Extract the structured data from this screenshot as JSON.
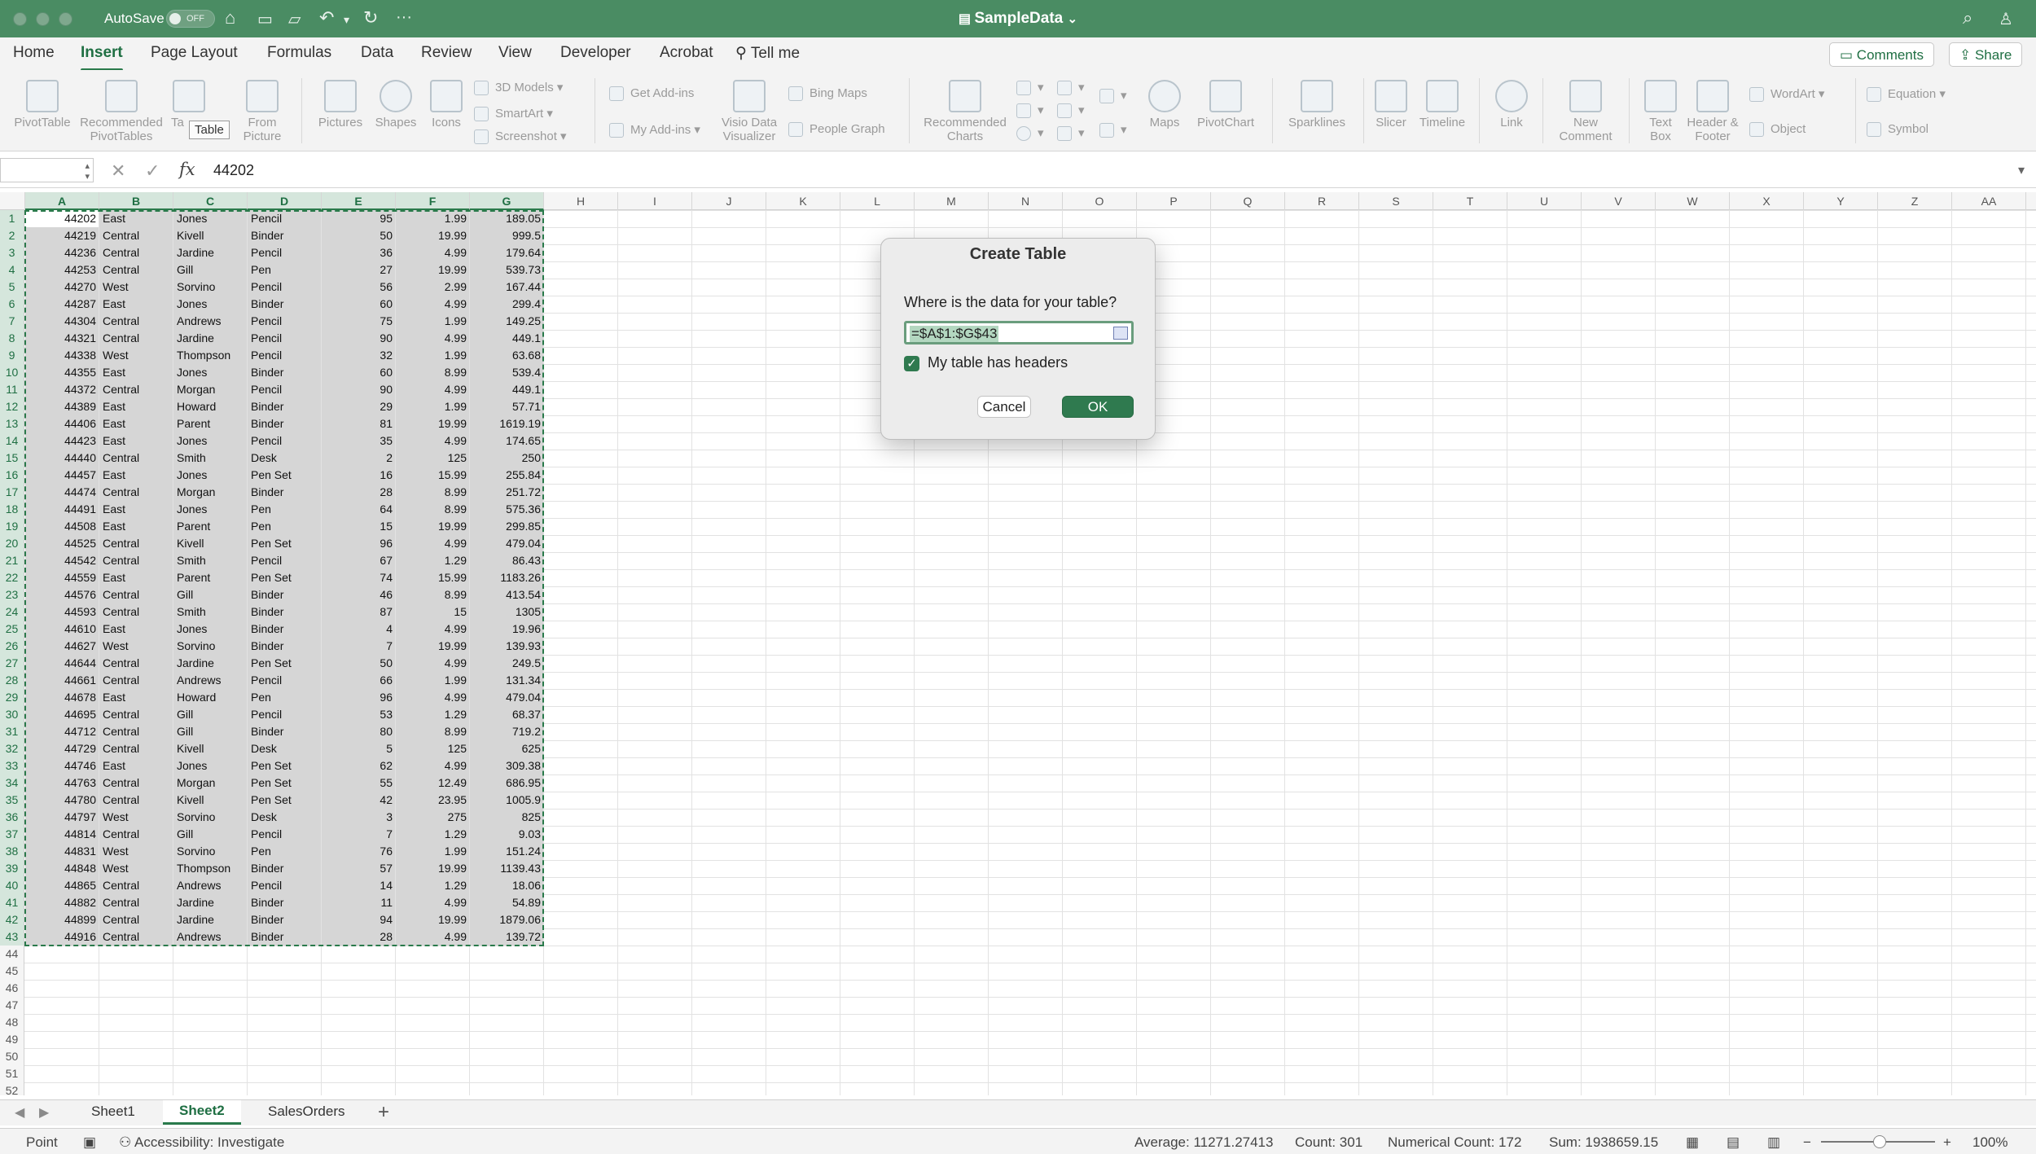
{
  "titlebar": {
    "autosave_label": "AutoSave",
    "autosave_state": "OFF",
    "doc_title": "SampleData",
    "title_chevron": "⌄"
  },
  "tabs": [
    "Home",
    "Insert",
    "Page Layout",
    "Formulas",
    "Data",
    "Review",
    "View",
    "Developer",
    "Acrobat",
    "Tell me"
  ],
  "active_tab": "Insert",
  "actions": {
    "comments": "Comments",
    "share": "Share"
  },
  "ribbon": {
    "pivottable": "PivotTable",
    "recommended_pivottables_1": "Recommended",
    "recommended_pivottables_2": "PivotTables",
    "table_partial": "Ta",
    "from_picture_1": "From",
    "from_picture_2": "Picture",
    "pictures": "Pictures",
    "shapes": "Shapes",
    "icons": "Icons",
    "models3d": "3D Models",
    "smartart": "SmartArt",
    "screenshot": "Screenshot",
    "get_addins": "Get Add-ins",
    "my_addins": "My Add-ins",
    "visio_1": "Visio Data",
    "visio_2": "Visualizer",
    "bing_maps": "Bing Maps",
    "people_graph": "People Graph",
    "recommended_charts_1": "Recommended",
    "recommended_charts_2": "Charts",
    "maps": "Maps",
    "pivotchart": "PivotChart",
    "sparklines": "Sparklines",
    "slicer": "Slicer",
    "timeline": "Timeline",
    "link": "Link",
    "new_comment_1": "New",
    "new_comment_2": "Comment",
    "textbox_1": "Text",
    "textbox_2": "Box",
    "header_footer_1": "Header &",
    "header_footer_2": "Footer",
    "wordart": "WordArt",
    "object": "Object",
    "equation": "Equation",
    "symbol": "Symbol",
    "tooltip": "Table"
  },
  "formula_bar": {
    "value": "44202"
  },
  "columns": [
    "A",
    "B",
    "C",
    "D",
    "E",
    "F",
    "G",
    "H",
    "I",
    "J",
    "K",
    "L",
    "M",
    "N",
    "O",
    "P",
    "Q",
    "R",
    "S",
    "T",
    "U",
    "V",
    "W",
    "X",
    "Y",
    "Z",
    "AA"
  ],
  "rows_count": 52,
  "table_rows": [
    [
      "44202",
      "East",
      "Jones",
      "Pencil",
      "95",
      "1.99",
      "189.05"
    ],
    [
      "44219",
      "Central",
      "Kivell",
      "Binder",
      "50",
      "19.99",
      "999.5"
    ],
    [
      "44236",
      "Central",
      "Jardine",
      "Pencil",
      "36",
      "4.99",
      "179.64"
    ],
    [
      "44253",
      "Central",
      "Gill",
      "Pen",
      "27",
      "19.99",
      "539.73"
    ],
    [
      "44270",
      "West",
      "Sorvino",
      "Pencil",
      "56",
      "2.99",
      "167.44"
    ],
    [
      "44287",
      "East",
      "Jones",
      "Binder",
      "60",
      "4.99",
      "299.4"
    ],
    [
      "44304",
      "Central",
      "Andrews",
      "Pencil",
      "75",
      "1.99",
      "149.25"
    ],
    [
      "44321",
      "Central",
      "Jardine",
      "Pencil",
      "90",
      "4.99",
      "449.1"
    ],
    [
      "44338",
      "West",
      "Thompson",
      "Pencil",
      "32",
      "1.99",
      "63.68"
    ],
    [
      "44355",
      "East",
      "Jones",
      "Binder",
      "60",
      "8.99",
      "539.4"
    ],
    [
      "44372",
      "Central",
      "Morgan",
      "Pencil",
      "90",
      "4.99",
      "449.1"
    ],
    [
      "44389",
      "East",
      "Howard",
      "Binder",
      "29",
      "1.99",
      "57.71"
    ],
    [
      "44406",
      "East",
      "Parent",
      "Binder",
      "81",
      "19.99",
      "1619.19"
    ],
    [
      "44423",
      "East",
      "Jones",
      "Pencil",
      "35",
      "4.99",
      "174.65"
    ],
    [
      "44440",
      "Central",
      "Smith",
      "Desk",
      "2",
      "125",
      "250"
    ],
    [
      "44457",
      "East",
      "Jones",
      "Pen Set",
      "16",
      "15.99",
      "255.84"
    ],
    [
      "44474",
      "Central",
      "Morgan",
      "Binder",
      "28",
      "8.99",
      "251.72"
    ],
    [
      "44491",
      "East",
      "Jones",
      "Pen",
      "64",
      "8.99",
      "575.36"
    ],
    [
      "44508",
      "East",
      "Parent",
      "Pen",
      "15",
      "19.99",
      "299.85"
    ],
    [
      "44525",
      "Central",
      "Kivell",
      "Pen Set",
      "96",
      "4.99",
      "479.04"
    ],
    [
      "44542",
      "Central",
      "Smith",
      "Pencil",
      "67",
      "1.29",
      "86.43"
    ],
    [
      "44559",
      "East",
      "Parent",
      "Pen Set",
      "74",
      "15.99",
      "1183.26"
    ],
    [
      "44576",
      "Central",
      "Gill",
      "Binder",
      "46",
      "8.99",
      "413.54"
    ],
    [
      "44593",
      "Central",
      "Smith",
      "Binder",
      "87",
      "15",
      "1305"
    ],
    [
      "44610",
      "East",
      "Jones",
      "Binder",
      "4",
      "4.99",
      "19.96"
    ],
    [
      "44627",
      "West",
      "Sorvino",
      "Binder",
      "7",
      "19.99",
      "139.93"
    ],
    [
      "44644",
      "Central",
      "Jardine",
      "Pen Set",
      "50",
      "4.99",
      "249.5"
    ],
    [
      "44661",
      "Central",
      "Andrews",
      "Pencil",
      "66",
      "1.99",
      "131.34"
    ],
    [
      "44678",
      "East",
      "Howard",
      "Pen",
      "96",
      "4.99",
      "479.04"
    ],
    [
      "44695",
      "Central",
      "Gill",
      "Pencil",
      "53",
      "1.29",
      "68.37"
    ],
    [
      "44712",
      "Central",
      "Gill",
      "Binder",
      "80",
      "8.99",
      "719.2"
    ],
    [
      "44729",
      "Central",
      "Kivell",
      "Desk",
      "5",
      "125",
      "625"
    ],
    [
      "44746",
      "East",
      "Jones",
      "Pen Set",
      "62",
      "4.99",
      "309.38"
    ],
    [
      "44763",
      "Central",
      "Morgan",
      "Pen Set",
      "55",
      "12.49",
      "686.95"
    ],
    [
      "44780",
      "Central",
      "Kivell",
      "Pen Set",
      "42",
      "23.95",
      "1005.9"
    ],
    [
      "44797",
      "West",
      "Sorvino",
      "Desk",
      "3",
      "275",
      "825"
    ],
    [
      "44814",
      "Central",
      "Gill",
      "Pencil",
      "7",
      "1.29",
      "9.03"
    ],
    [
      "44831",
      "West",
      "Sorvino",
      "Pen",
      "76",
      "1.99",
      "151.24"
    ],
    [
      "44848",
      "West",
      "Thompson",
      "Binder",
      "57",
      "19.99",
      "1139.43"
    ],
    [
      "44865",
      "Central",
      "Andrews",
      "Pencil",
      "14",
      "1.29",
      "18.06"
    ],
    [
      "44882",
      "Central",
      "Jardine",
      "Binder",
      "11",
      "4.99",
      "54.89"
    ],
    [
      "44899",
      "Central",
      "Jardine",
      "Binder",
      "94",
      "19.99",
      "1879.06"
    ],
    [
      "44916",
      "Central",
      "Andrews",
      "Binder",
      "28",
      "4.99",
      "139.72"
    ]
  ],
  "dialog": {
    "title": "Create Table",
    "question": "Where is the data for your table?",
    "range": "=$A$1:$G$43",
    "headers_label": "My table has headers",
    "headers_checked": true,
    "cancel": "Cancel",
    "ok": "OK"
  },
  "sheets": [
    "Sheet1",
    "Sheet2",
    "SalesOrders"
  ],
  "active_sheet": "Sheet2",
  "add_sheet": "+",
  "status": {
    "mode": "Point",
    "accessibility": "Accessibility: Investigate",
    "average": "Average: 11271.27413",
    "count": "Count: 301",
    "numerical_count": "Numerical Count: 172",
    "sum": "Sum: 1938659.15",
    "zoom": "100%"
  },
  "colors": {
    "accent": "#4a8c63",
    "ok_button": "#2f7a4f",
    "selection_border": "#2a7a4b"
  }
}
